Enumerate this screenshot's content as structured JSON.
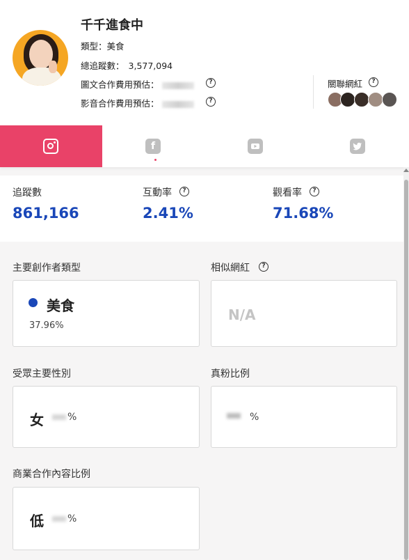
{
  "profile": {
    "name": "千千進食中",
    "type_label": "類型：",
    "type_value": "美食",
    "followers_label": "總追蹤數：",
    "followers_value": "3,577,094",
    "image_fee_label": "圖文合作費用預估：",
    "video_fee_label": "影音合作費用預估：",
    "related_label": "關聯網紅"
  },
  "tabs": [
    {
      "platform": "instagram",
      "icon": "instagram-icon",
      "active": true
    },
    {
      "platform": "facebook",
      "icon": "facebook-icon",
      "glyph": "f",
      "active": false
    },
    {
      "platform": "youtube",
      "icon": "youtube-icon",
      "active": false
    },
    {
      "platform": "twitter",
      "icon": "twitter-icon",
      "active": false
    }
  ],
  "stats": {
    "followers_label": "追蹤數",
    "followers_value": "861,166",
    "engagement_label": "互動率",
    "engagement_value": "2.41%",
    "view_rate_label": "觀看率",
    "view_rate_value": "71.68%"
  },
  "sections": {
    "creator_type_label": "主要創作者類型",
    "creator_type_value": "美食",
    "creator_type_pct": "37.96%",
    "similar_label": "相似網紅",
    "similar_value": "N/A",
    "gender_label": "受眾主要性別",
    "gender_value": "女",
    "gender_unit": "%",
    "real_fans_label": "真粉比例",
    "real_fans_unit": "%",
    "commercial_label": "商業合作內容比例",
    "commercial_value": "低",
    "commercial_unit": "%"
  },
  "colors": {
    "accent": "#e94268",
    "value_blue": "#1a47b8",
    "tab_inactive": "#bfbfbf"
  }
}
